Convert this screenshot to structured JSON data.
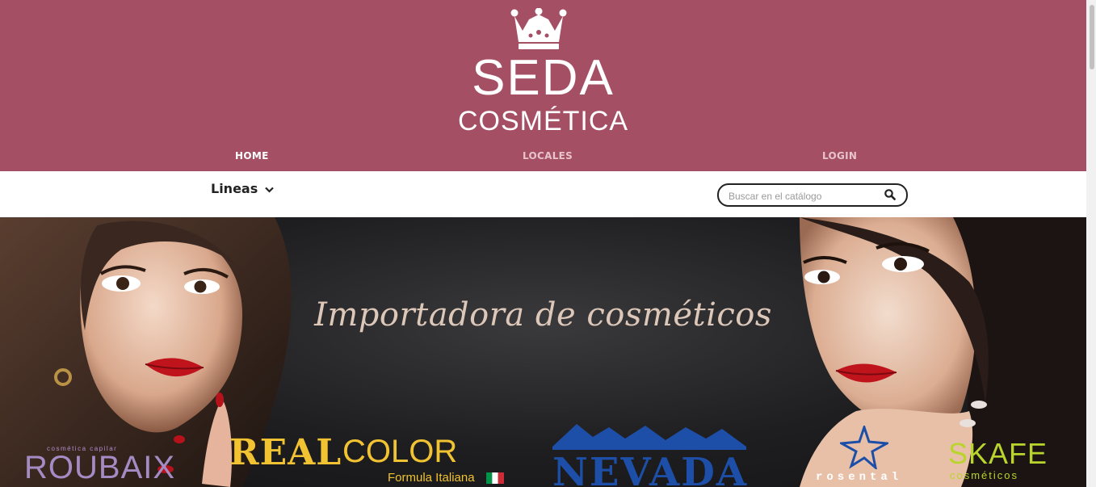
{
  "header": {
    "logo_line1": "SEDA",
    "logo_line2": "COSMÉTICA",
    "background_color": "#a54f65"
  },
  "nav": {
    "items": [
      {
        "label": "HOME",
        "active": true
      },
      {
        "label": "LOCALES",
        "active": false
      },
      {
        "label": "LOGIN",
        "active": false
      }
    ]
  },
  "toolbar": {
    "lineas_label": "Lineas",
    "search_placeholder": "Buscar en el catálogo",
    "search_value": ""
  },
  "banner": {
    "tagline": "Importadora de cosméticos",
    "brands": {
      "roubaix": {
        "sub": "cosmética capilar",
        "name": "ROUBAIX"
      },
      "realcolor": {
        "name_a": "REAL",
        "name_b": "COLOR",
        "sub": "Formula Italiana"
      },
      "nevada": {
        "name": "NEVADA"
      },
      "rosental": {
        "name": "rosental"
      },
      "skafe": {
        "name": "SKAFE",
        "sub": "cosméticos"
      }
    }
  },
  "icons": {
    "logo": "crown-icon",
    "dropdown": "chevron-down-icon",
    "search": "search-icon"
  }
}
